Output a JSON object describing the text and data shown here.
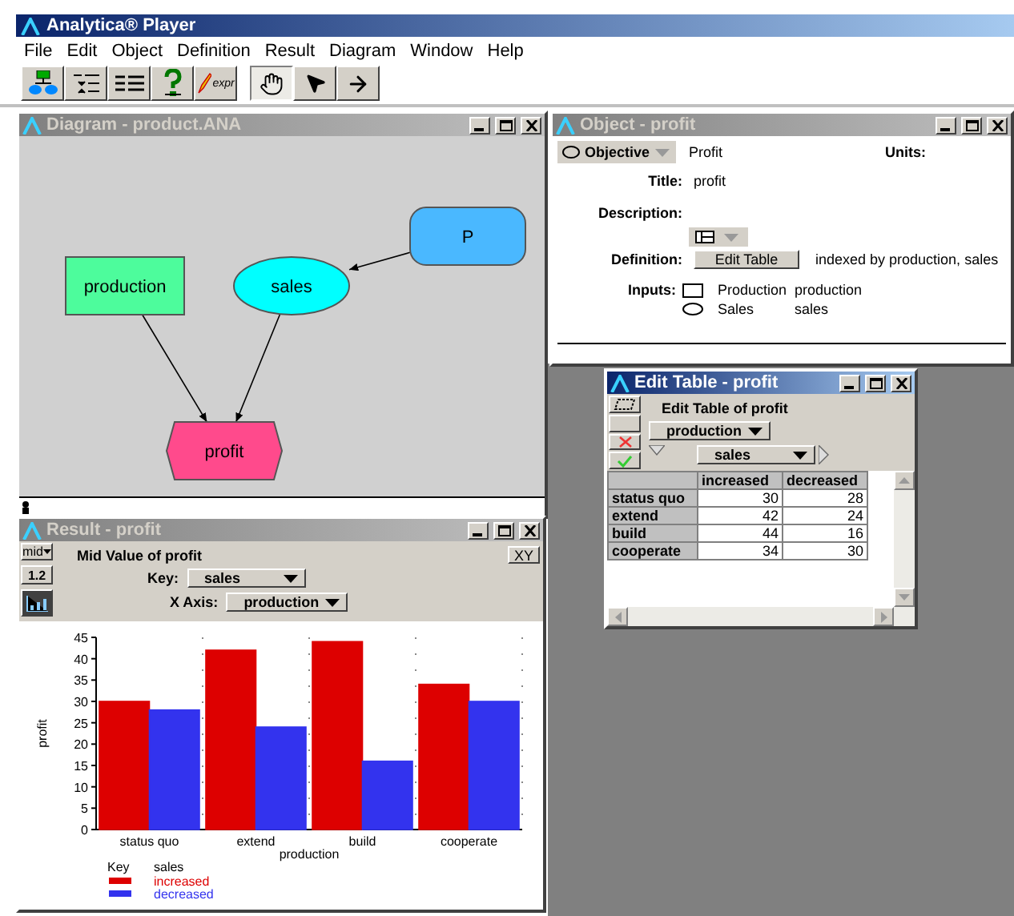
{
  "app": {
    "title": "Analytica® Player",
    "menu": [
      "File",
      "Edit",
      "Object",
      "Definition",
      "Result",
      "Diagram",
      "Window",
      "Help"
    ],
    "toolbar": [
      {
        "kind": "diagram",
        "selected": false
      },
      {
        "kind": "outline",
        "selected": false
      },
      {
        "kind": "list",
        "selected": false
      },
      {
        "kind": "help",
        "selected": false
      },
      {
        "kind": "expr",
        "label": "expr",
        "selected": false
      },
      {
        "kind": "hand",
        "selected": true
      },
      {
        "kind": "pointer",
        "selected": false
      },
      {
        "kind": "arrow",
        "selected": false
      }
    ]
  },
  "diagram_window": {
    "title": "Diagram - product.ANA",
    "active": false,
    "nodes": [
      {
        "kind": "decision",
        "label": "production",
        "color": "#4dfc9c"
      },
      {
        "kind": "chance",
        "label": "sales",
        "color": "#00ffff"
      },
      {
        "kind": "objective",
        "label": "profit",
        "color": "#ff4a8c"
      },
      {
        "kind": "variable",
        "label": "P",
        "color": "#4ab8ff"
      }
    ]
  },
  "object_window": {
    "title": "Object - profit",
    "active": false,
    "class": "Objective",
    "identifier": "Profit",
    "units_label": "Units:",
    "title_label": "Title:",
    "title_value": "profit",
    "description_label": "Description:",
    "definition_label": "Definition:",
    "definition_button": "Edit Table",
    "definition_note": "indexed by production, sales",
    "inputs_label": "Inputs:",
    "inputs": [
      {
        "kind": "decision",
        "title": "Production",
        "identifier": "production"
      },
      {
        "kind": "chance",
        "title": "Sales",
        "identifier": "sales"
      }
    ]
  },
  "edit_table_window": {
    "title": "Edit Table - profit",
    "active": true,
    "heading": "Edit Table of profit",
    "row_index": "production",
    "column_index": "sales",
    "columns": [
      "increased",
      "decreased"
    ],
    "rows": [
      {
        "label": "status quo",
        "values": [
          "30",
          "28"
        ]
      },
      {
        "label": "extend",
        "values": [
          "42",
          "24"
        ]
      },
      {
        "label": "build",
        "values": [
          "44",
          "16"
        ]
      },
      {
        "label": "cooperate",
        "values": [
          "34",
          "30"
        ]
      }
    ]
  },
  "result_window": {
    "title": "Result - profit",
    "active": false,
    "uncertainty_view": "mid",
    "table_view_label": "1.2",
    "graph_view_selected": true,
    "heading": "Mid Value of profit",
    "xy_button": "XY",
    "legend_title": "Key",
    "legend_index": "sales",
    "key_label": "Key:",
    "key_value": "sales",
    "xaxis_label": "X Axis:",
    "xaxis_value": "production",
    "chart_data": {
      "type": "bar",
      "xlabel": "production",
      "ylabel": "profit",
      "categories": [
        "status quo",
        "extend",
        "build",
        "cooperate"
      ],
      "series": [
        {
          "name": "increased",
          "color": "#dd0000",
          "values": [
            30,
            42,
            44,
            34
          ]
        },
        {
          "name": "decreased",
          "color": "#3333ee",
          "values": [
            28,
            24,
            16,
            30
          ]
        }
      ],
      "legend": "bottom",
      "ylim": [
        0,
        45
      ],
      "yticks": [
        0,
        5,
        10,
        15,
        20,
        25,
        30,
        35,
        40,
        45
      ]
    }
  }
}
